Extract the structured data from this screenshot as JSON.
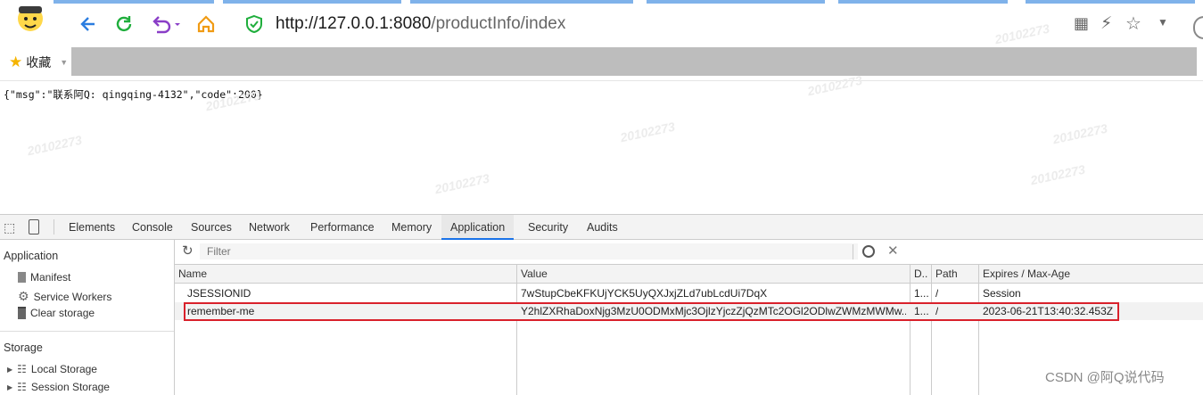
{
  "browser": {
    "url_host": "http://127.0.0.1:8080",
    "url_path": "/productInfo/index",
    "bookmark_label": "收藏"
  },
  "page": {
    "json_body": "{\"msg\":\"联系阿Q: qingqing-4132\",\"code\":200}"
  },
  "watermark": "20102273",
  "devtools": {
    "tabs": [
      "Elements",
      "Console",
      "Sources",
      "Network",
      "Performance",
      "Memory",
      "Application",
      "Security",
      "Audits"
    ],
    "active_tab": "Application",
    "filter_placeholder": "Filter",
    "sidebar": {
      "application_header": "Application",
      "application_items": [
        "Manifest",
        "Service Workers",
        "Clear storage"
      ],
      "storage_header": "Storage",
      "storage_items": [
        "Local Storage",
        "Session Storage"
      ]
    },
    "table": {
      "columns": [
        "Name",
        "Value",
        "D..",
        "Path",
        "Expires / Max-Age"
      ],
      "rows": [
        {
          "name": "JSESSIONID",
          "value": "7wStupCbeKFKUjYCK5UyQXJxjZLd7ubLcdUi7DqX",
          "domain": "1...",
          "path": "/",
          "expires": "Session"
        },
        {
          "name": "remember-me",
          "value": "Y2hlZXRhaDoxNjg3MzU0ODMxMjc3OjlzYjczZjQzMTc2OGl2ODlwZWMzMWMw...",
          "domain": "1...",
          "path": "/",
          "expires": "2023-06-21T13:40:32.453Z"
        }
      ]
    }
  },
  "footer_watermark": "CSDN @阿Q说代码",
  "colors": {
    "accent": "#1a73e8",
    "highlight_box": "#d9212b",
    "tab_accent": "#7fb2ea"
  }
}
